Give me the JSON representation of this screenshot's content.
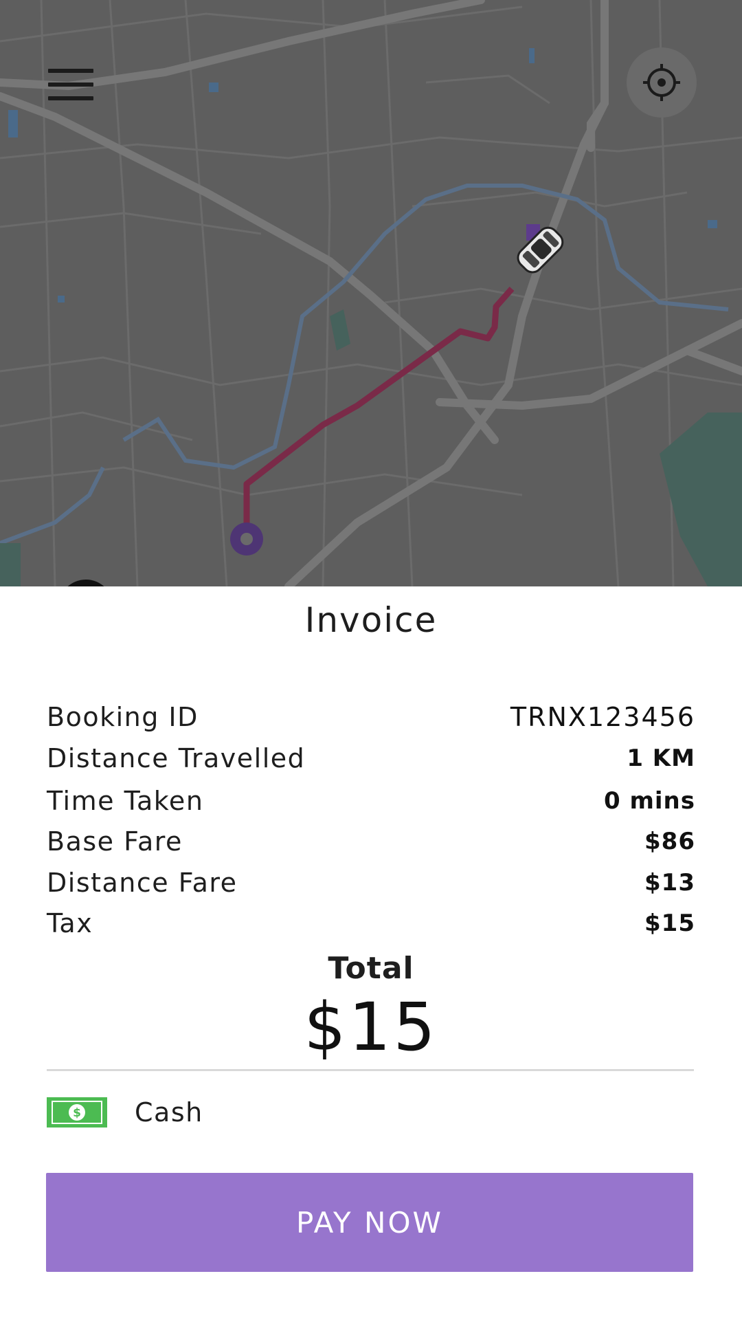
{
  "map": {
    "menu_icon": "hamburger-menu-icon",
    "locate_icon": "crosshair-locate-icon",
    "vehicle_icon": "car-icon",
    "pickup_icon": "pickup-marker-icon",
    "route_color": "#7a2a48",
    "background_color": "#5e5e5e"
  },
  "invoice": {
    "title": "Invoice",
    "rows": [
      {
        "label": "Booking ID",
        "value": "TRNX123456"
      },
      {
        "label": "Distance Travelled",
        "value": "1 KM"
      },
      {
        "label": "Time Taken",
        "value": "0 mins"
      },
      {
        "label": "Base Fare",
        "value": "$86"
      },
      {
        "label": "Distance Fare",
        "value": "$13"
      },
      {
        "label": "Tax",
        "value": "$15"
      }
    ],
    "total_label": "Total",
    "total_value": "$15"
  },
  "payment": {
    "method": "Cash",
    "icon": "cash-icon",
    "icon_color": "#4cbb52"
  },
  "actions": {
    "pay_label": "PAY NOW",
    "button_color": "#9775cd"
  }
}
